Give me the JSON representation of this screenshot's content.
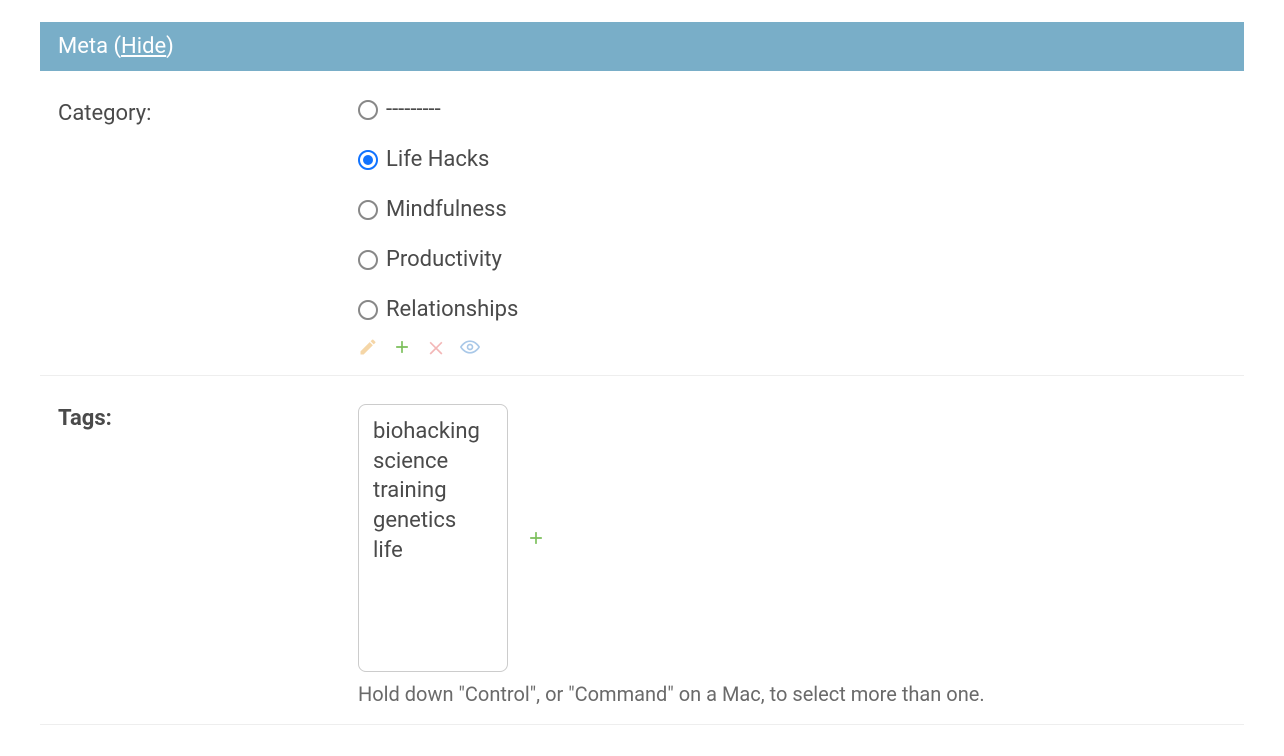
{
  "panel": {
    "title_prefix": "Meta (",
    "title_link": "Hide",
    "title_suffix": ")"
  },
  "category": {
    "label": "Category:",
    "options": [
      {
        "label": "---------",
        "selected": false
      },
      {
        "label": "Life Hacks",
        "selected": true
      },
      {
        "label": "Mindfulness",
        "selected": false
      },
      {
        "label": "Productivity",
        "selected": false
      },
      {
        "label": "Relationships",
        "selected": false
      }
    ],
    "actions": {
      "edit_icon": "pencil-icon",
      "add_icon": "plus-icon",
      "delete_icon": "x-icon",
      "view_icon": "eye-icon"
    }
  },
  "tags": {
    "label": "Tags:",
    "options": [
      "biohacking",
      "science",
      "training",
      "genetics",
      "life"
    ],
    "add_icon": "plus-icon",
    "help": "Hold down \"Control\", or \"Command\" on a Mac, to select more than one."
  }
}
